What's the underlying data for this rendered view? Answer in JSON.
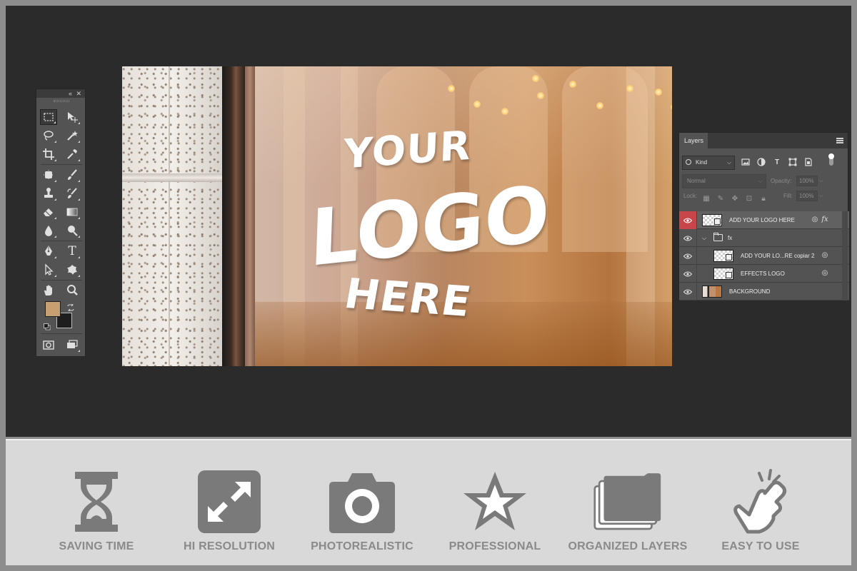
{
  "colors": {
    "workspace": "#2b2b2b",
    "band": "#d9d9d9",
    "foreground_swatch": "#c69f72",
    "background_swatch": "#1e1e1e",
    "active_eye": "#c8454a",
    "feature_gray": "#7a7a7a"
  },
  "tools_panel": {
    "collapse_glyph": "«",
    "close_glyph": "✕",
    "tools": [
      {
        "name": "rectangular-marquee-tool-icon"
      },
      {
        "name": "move-tool-icon"
      },
      {
        "name": "lasso-tool-icon"
      },
      {
        "name": "magic-wand-tool-icon"
      },
      {
        "name": "crop-tool-icon"
      },
      {
        "name": "eyedropper-tool-icon"
      },
      {
        "name": "spot-healing-tool-icon"
      },
      {
        "name": "brush-tool-icon"
      },
      {
        "name": "clone-stamp-tool-icon"
      },
      {
        "name": "history-brush-tool-icon"
      },
      {
        "name": "eraser-tool-icon"
      },
      {
        "name": "gradient-tool-icon"
      },
      {
        "name": "blur-tool-icon"
      },
      {
        "name": "dodge-tool-icon"
      },
      {
        "name": "pen-tool-icon"
      },
      {
        "name": "type-tool-icon"
      },
      {
        "name": "path-selection-tool-icon"
      },
      {
        "name": "custom-shape-tool-icon"
      },
      {
        "name": "hand-tool-icon"
      },
      {
        "name": "zoom-tool-icon"
      },
      {
        "name": "quick-mask-icon"
      },
      {
        "name": "screen-mode-icon"
      }
    ],
    "type_tool_glyph": "T"
  },
  "canvas": {
    "logo_line1": "YOUR",
    "logo_line2": "LOGO",
    "logo_line3": "HERE"
  },
  "layers_panel": {
    "tab_label": "Layers",
    "filter_kind": "Kind",
    "blend_mode": "Normal",
    "opacity_label": "Opacity:",
    "opacity_value": "100%",
    "lock_label": "Lock:",
    "fill_label": "Fill:",
    "fill_value": "100%",
    "type_filter_glyph": "T",
    "layers": [
      {
        "name": "ADD YOUR LOGO HERE",
        "visible": true,
        "selected": true,
        "fx": "fx"
      },
      {
        "name": "fx",
        "visible": true,
        "group": true
      },
      {
        "name": "ADD YOUR LO...RE copiar 2",
        "visible": true
      },
      {
        "name": "EFFECTS LOGO",
        "visible": true
      },
      {
        "name": "BACKGROUND",
        "visible": true
      }
    ]
  },
  "features": [
    {
      "label": "SAVING TIME",
      "icon": "hourglass-icon"
    },
    {
      "label": "HI RESOLUTION",
      "icon": "expand-arrows-icon"
    },
    {
      "label": "PHOTOREALISTIC",
      "icon": "camera-icon"
    },
    {
      "label": "PROFESSIONAL",
      "icon": "star-icon"
    },
    {
      "label": "ORGANIZED LAYERS",
      "icon": "stacked-folders-icon"
    },
    {
      "label": "EASY TO USE",
      "icon": "tapping-hand-icon"
    }
  ]
}
